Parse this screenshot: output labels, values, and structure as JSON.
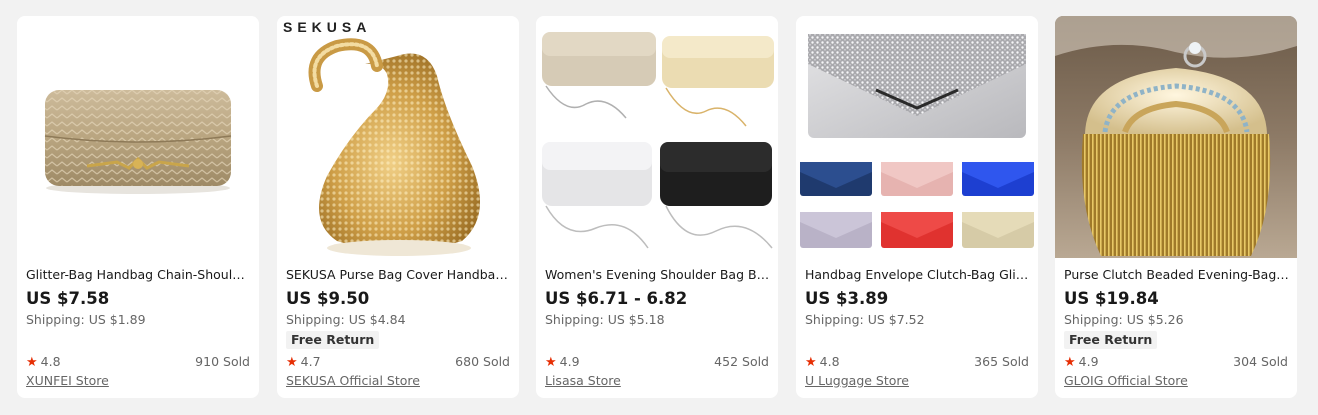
{
  "products": [
    {
      "title": "Glitter-Bag Handbag Chain-Shoulder-Bag Evening Clutch",
      "price": "US $7.58",
      "shipping": "Shipping: US $1.89",
      "badge": "",
      "rating": "4.8",
      "sold": "910 Sold",
      "store": "XUNFEI Store"
    },
    {
      "title": "SEKUSA Purse Bag Cover Handbag Diamonds Rhinestone",
      "price": "US $9.50",
      "shipping": "Shipping: US $4.84",
      "badge": "Free Return",
      "rating": "4.7",
      "sold": "680 Sold",
      "store": "SEKUSA Official Store",
      "brand_text": "SEKUSA"
    },
    {
      "title": "Women's Evening Shoulder Bag Bright Silk Clutch",
      "price": "US $6.71 - 6.82",
      "shipping": "Shipping: US $5.18",
      "badge": "",
      "rating": "4.9",
      "sold": "452 Sold",
      "store": "Lisasa Store"
    },
    {
      "title": "Handbag Envelope Clutch-Bag Glitter Sequins Purse",
      "price": "US $3.89",
      "shipping": "Shipping: US $7.52",
      "badge": "",
      "rating": "4.8",
      "sold": "365 Sold",
      "store": "U Luggage Store"
    },
    {
      "title": "Purse Clutch Beaded Evening-Bags Tassel Ring",
      "price": "US $19.84",
      "shipping": "Shipping: US $5.26",
      "badge": "Free Return",
      "rating": "4.9",
      "sold": "304 Sold",
      "store": "GLOIG Official Store"
    }
  ],
  "icons": {
    "rating": "star-icon"
  },
  "colors": {
    "star": "#e62e04",
    "price": "#191919",
    "page_bg": "#f2f2f2"
  }
}
